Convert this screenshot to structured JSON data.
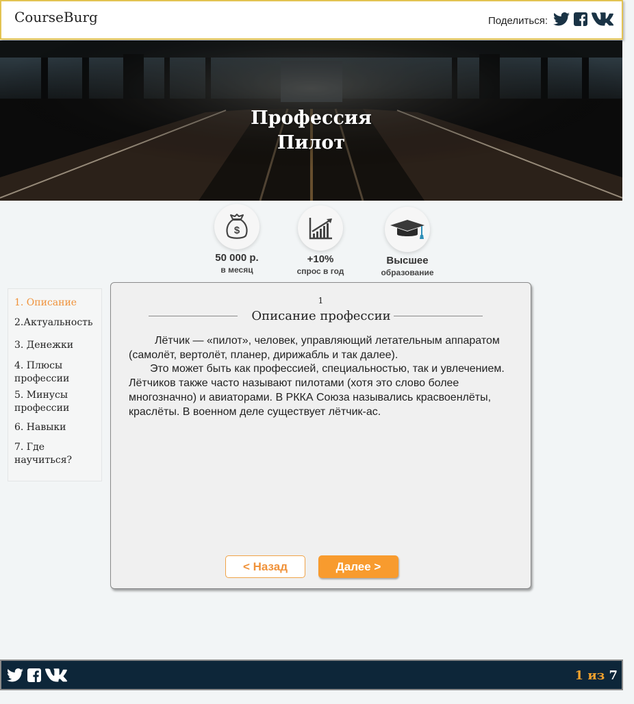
{
  "header": {
    "logo": "CourseBurg",
    "share_label": "Поделиться:",
    "icons": [
      "twitter-icon",
      "facebook-icon",
      "vk-icon"
    ]
  },
  "hero": {
    "title_line1": "Профессия",
    "title_line2": "Пилот"
  },
  "stats": [
    {
      "icon": "money-bag-icon",
      "value": "50 000 р.",
      "sub": "в месяц"
    },
    {
      "icon": "growth-chart-icon",
      "value": "+10%",
      "sub": "спрос в год"
    },
    {
      "icon": "graduation-cap-icon",
      "value": "Высшее",
      "sub": "образование"
    }
  ],
  "nav": {
    "items": [
      {
        "line1": "1. Описание",
        "line2": ""
      },
      {
        "line1": "2.Актуальность",
        "line2": ""
      },
      {
        "line1": "3. Денежки",
        "line2": ""
      },
      {
        "line1": "4. Плюсы",
        "line2": "профессии"
      },
      {
        "line1": "5. Минусы",
        "line2": "профессии"
      },
      {
        "line1": "6. Навыки",
        "line2": ""
      },
      {
        "line1": "7. Где",
        "line2": "научиться?"
      }
    ],
    "active_color": "#f0923a"
  },
  "content": {
    "step": "1",
    "title": "Описание профессии",
    "p1": "Лётчик — «пилот», человек, управляющий летательным аппаратом (самолёт, вертолёт, планер, дирижабль и так далее).",
    "p2": "Это может быть как профессией, специальностью, так и увлечением. Лётчиков  также часто называют пилотами (хотя это слово более многозначно) и авиаторами. В РККА Союза назывались красвоенлёты, краслёты. В военном деле существует лётчик-ас.",
    "back_label": "< Назад",
    "next_label": "Далее  >"
  },
  "footer": {
    "icons": [
      "twitter-icon",
      "facebook-icon",
      "vk-icon"
    ],
    "page_current": "1",
    "page_of": "из",
    "page_total": "7"
  },
  "colors": {
    "accent": "#f89b2e",
    "header_border": "#e3c352",
    "footer_bg": "#0d2639",
    "social_dark": "#1a3345"
  }
}
